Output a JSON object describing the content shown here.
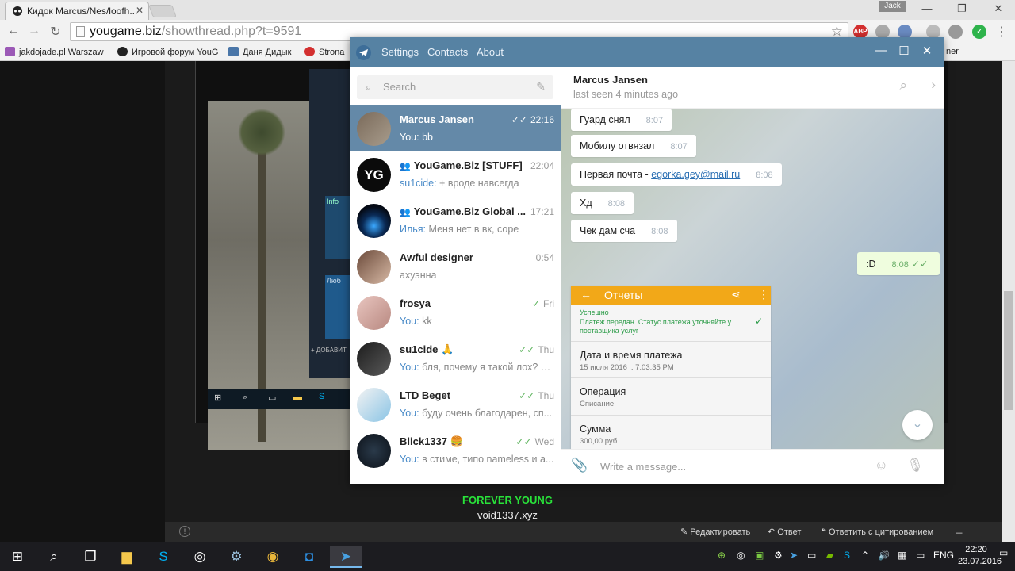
{
  "browser": {
    "tab_title": "Кидок Marcus/Nes/loofh...",
    "user": "Jack",
    "url_host": "yougame.biz",
    "url_path": "/showthread.php?t=9591",
    "bookmarks": [
      "jakdojade.pl Warszaw",
      "Игровой форум YouG",
      "Даня Дидык",
      "Strona",
      "ner"
    ],
    "extensions": [
      "ABP"
    ]
  },
  "page": {
    "signature_line1": "FOREVER YOUNG",
    "signature_line2": "void1337.xyz",
    "actions": [
      "Редактировать",
      "Ответ",
      "Ответить с цитированием"
    ],
    "card1": "Info",
    "card2": "Люб",
    "add_button": "+ ДОБАВИТ"
  },
  "telegram": {
    "menu": [
      "Settings",
      "Contacts",
      "About"
    ],
    "search_placeholder": "Search",
    "dialogs": [
      {
        "name": "Marcus Jansen",
        "time": "22:16",
        "sender": "You:",
        "text": "bb",
        "active": true,
        "check": "✓✓"
      },
      {
        "name": "YouGame.Biz [STUFF]",
        "time": "22:04",
        "sender": "su1cide:",
        "text": "+ вроде навсегда",
        "group": true
      },
      {
        "name": "YouGame.Biz Global ...",
        "time": "17:21",
        "sender": "Илья:",
        "text": "Меня нет в вк, соре",
        "group": true
      },
      {
        "name": "Awful designer",
        "time": "0:54",
        "sender": "",
        "text": "ахуэнна"
      },
      {
        "name": "frosya",
        "time": "Fri",
        "sender": "You:",
        "text": "kk",
        "check": "✓"
      },
      {
        "name": "su1cide 🙏",
        "time": "Thu",
        "sender": "You:",
        "text": "бля, почему я такой лох? у ...",
        "check": "✓✓"
      },
      {
        "name": "LTD Beget",
        "time": "Thu",
        "sender": "You:",
        "text": "буду очень благодарен, сп...",
        "check": "✓✓"
      },
      {
        "name": "Blick1337 🍔",
        "time": "Wed",
        "sender": "You:",
        "text": "в стиме, типо nameless и а...",
        "check": "✓✓"
      }
    ],
    "chat": {
      "peer_name": "Marcus Jansen",
      "peer_status": "last seen 4 minutes ago",
      "messages": [
        {
          "text": "Гуард снял",
          "time": "8:07"
        },
        {
          "text": "Мобилу отвязал",
          "time": "8:07"
        },
        {
          "text": "Первая почта - ",
          "link": "egorka.gey@mail.ru",
          "time": "8:08"
        },
        {
          "text": "Хд",
          "time": "8:08"
        },
        {
          "text": "Чек дам сча",
          "time": "8:08"
        },
        {
          "text": ":D",
          "time": "8:08",
          "outgoing": true,
          "check": "✓✓"
        }
      ],
      "screenshot": {
        "header": "Отчеты",
        "status_title": "Успешно",
        "status_text": "Платеж передан. Статус платежа уточняйте у поставщика услуг",
        "date_label": "Дата и время платежа",
        "date_value": "15 июля 2016 г. 7:03:35 PM",
        "op_label": "Операция",
        "op_value": "Списание",
        "sum_label": "Сумма",
        "sum_value": "300,00 руб."
      },
      "compose_placeholder": "Write a message..."
    }
  },
  "taskbar": {
    "language": "ENG",
    "time": "22:20",
    "date": "23.07.2016"
  },
  "colors": {
    "telegram_header": "#5682a3",
    "active_dialog": "#6489a8",
    "signature_green": "#29e33a"
  }
}
